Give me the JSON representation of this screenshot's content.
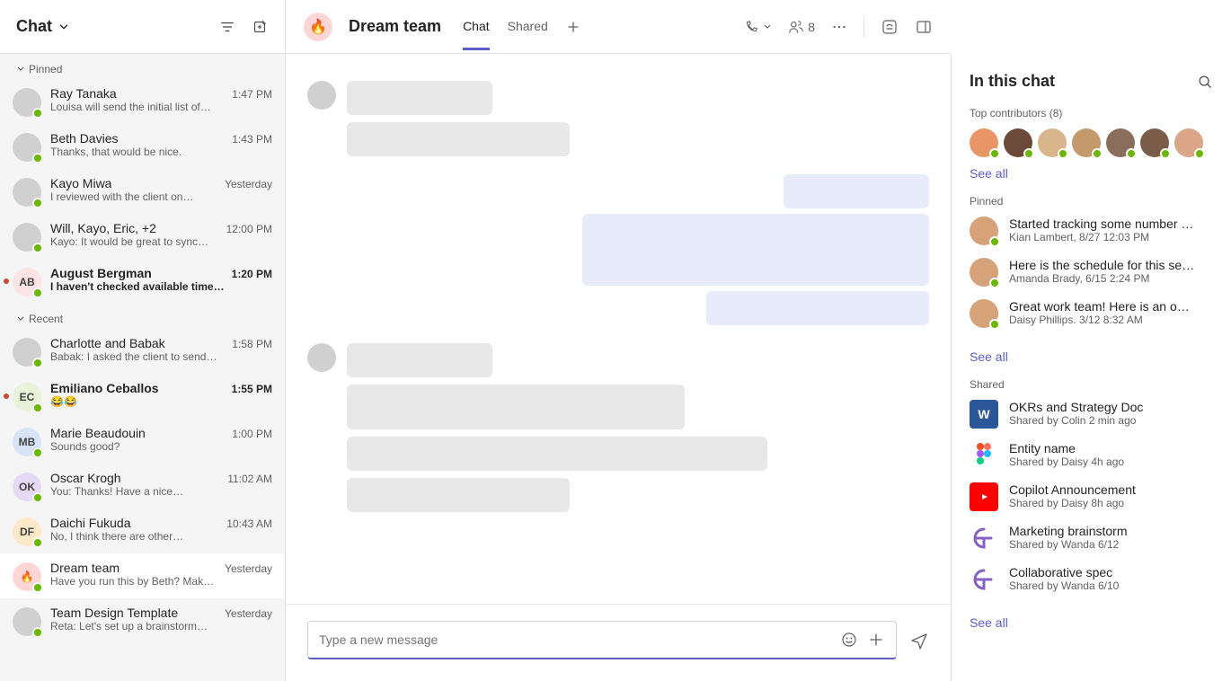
{
  "sidebar": {
    "title": "Chat",
    "sections": {
      "pinned_label": "Pinned",
      "recent_label": "Recent"
    }
  },
  "chat_list": {
    "pinned": [
      {
        "name": "Ray Tanaka",
        "preview": "Louisa will send the initial list of…",
        "time": "1:47 PM"
      },
      {
        "name": "Beth Davies",
        "preview": "Thanks, that would be nice.",
        "time": "1:43 PM"
      },
      {
        "name": "Kayo Miwa",
        "preview": "I reviewed with the client on…",
        "time": "Yesterday"
      },
      {
        "name": "Will, Kayo, Eric, +2",
        "preview": "Kayo: It would be great to sync…",
        "time": "12:00 PM"
      },
      {
        "name": "August Bergman",
        "preview": "I haven't checked available time…",
        "time": "1:20 PM",
        "unread": true,
        "initials": "AB",
        "color": "#fce4e4"
      }
    ],
    "recent": [
      {
        "name": "Charlotte and Babak",
        "preview": "Babak: I asked the client to send…",
        "time": "1:58 PM"
      },
      {
        "name": "Emiliano Ceballos",
        "preview": "😂😂",
        "time": "1:55 PM",
        "unread": true,
        "initials": "EC",
        "color": "#e8f2d8"
      },
      {
        "name": "Marie Beaudouin",
        "preview": "Sounds good?",
        "time": "1:00 PM",
        "initials": "MB",
        "color": "#d6e4f5"
      },
      {
        "name": "Oscar Krogh",
        "preview": "You: Thanks! Have a nice…",
        "time": "11:02 AM",
        "initials": "OK",
        "color": "#e6d9f5"
      },
      {
        "name": "Daichi Fukuda",
        "preview": "No, I think there are other…",
        "time": "10:43 AM",
        "initials": "DF",
        "color": "#fde9c7"
      },
      {
        "name": "Dream team",
        "preview": "Have you run this by Beth? Mak…",
        "time": "Yesterday",
        "active": true,
        "emoji": "🔥",
        "color": "#ffd6d6"
      },
      {
        "name": "Team Design Template",
        "preview": "Reta: Let's set up a brainstorm…",
        "time": "Yesterday"
      }
    ]
  },
  "main": {
    "avatar_emoji": "🔥",
    "title": "Dream team",
    "tabs": {
      "chat": "Chat",
      "shared": "Shared"
    },
    "participants_count": "8",
    "compose_placeholder": "Type a new message"
  },
  "right": {
    "title": "In this chat",
    "contributors_label": "Top contributors (8)",
    "see_all": "See all",
    "pinned_label": "Pinned",
    "shared_label": "Shared",
    "pinned": [
      {
        "title": "Started tracking some number …",
        "meta": "Kian Lambert, 8/27 12:03 PM"
      },
      {
        "title": "Here is the schedule for this se…",
        "meta": "Amanda Brady, 6/15 2:24 PM"
      },
      {
        "title": "Great work team! Here is an o…",
        "meta": "Daisy Phillips. 3/12 8:32 AM"
      }
    ],
    "shared": [
      {
        "title": "OKRs and Strategy Doc",
        "meta": "Shared by Colin 2 min ago",
        "icon": "word"
      },
      {
        "title": "Entity name",
        "meta": "Shared by Daisy 4h ago",
        "icon": "figma"
      },
      {
        "title": "Copilot Announcement",
        "meta": "Shared by Daisy 8h ago",
        "icon": "youtube"
      },
      {
        "title": "Marketing brainstorm",
        "meta": "Shared by Wanda 6/12",
        "icon": "loop"
      },
      {
        "title": "Collaborative spec",
        "meta": "Shared by Wanda 6/10",
        "icon": "loop"
      }
    ]
  }
}
